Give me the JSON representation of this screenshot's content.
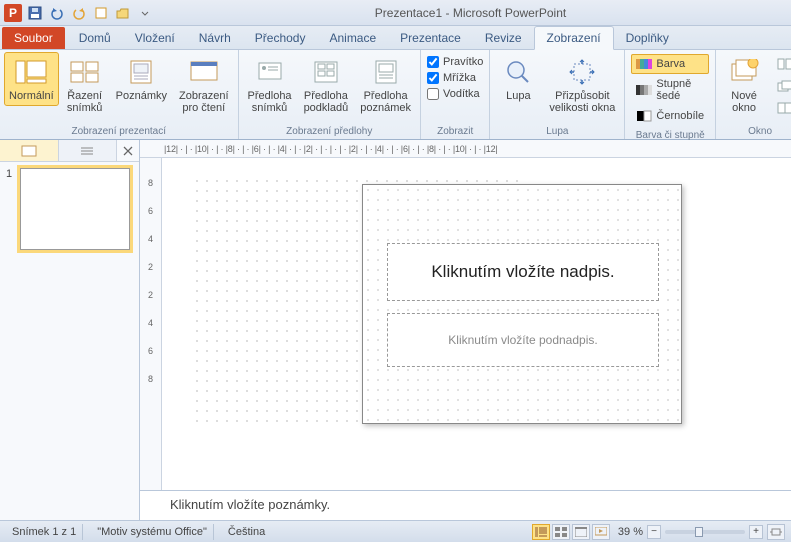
{
  "title": "Prezentace1 - Microsoft PowerPoint",
  "tabs": {
    "file": "Soubor",
    "home": "Domů",
    "insert": "Vložení",
    "design": "Návrh",
    "transitions": "Přechody",
    "animations": "Animace",
    "slideshow": "Prezentace",
    "review": "Revize",
    "view": "Zobrazení",
    "addins": "Doplňky"
  },
  "ribbon": {
    "views": {
      "normal": "Normální",
      "sorter": "Řazení\nsnímků",
      "notes": "Poznámky",
      "reading": "Zobrazení\npro čtení",
      "group": "Zobrazení prezentací"
    },
    "masters": {
      "slide": "Předloha\nsnímků",
      "handout": "Předloha\npodkladů",
      "notes": "Předloha\npoznámek",
      "group": "Zobrazení předlohy"
    },
    "show": {
      "ruler": "Pravítko",
      "grid": "Mřížka",
      "guides": "Vodítka",
      "group": "Zobrazit"
    },
    "zoom": {
      "zoom": "Lupa",
      "fit": "Přizpůsobit\nvelikosti okna",
      "group": "Lupa"
    },
    "color": {
      "color": "Barva",
      "gray": "Stupně šedé",
      "bw": "Černobíle",
      "group": "Barva či stupně šedé"
    },
    "window": {
      "new": "Nové\nokno",
      "group": "Okno"
    }
  },
  "ruler_h": "|12| · | · |10| · | · |8| · | · |6| · | · |4| · | · |2| · | · | · | · |2| · | · |4| · | · |6| · | · |8| · | · |10| · | · |12|",
  "ruler_v": [
    "8",
    "6",
    "4",
    "2",
    "2",
    "4",
    "6",
    "8"
  ],
  "slide": {
    "num": "1",
    "title_ph": "Kliknutím vložíte nadpis.",
    "sub_ph": "Kliknutím vložíte podnadpis."
  },
  "notes_ph": "Kliknutím vložíte poznámky.",
  "status": {
    "slide": "Snímek 1 z 1",
    "theme": "\"Motiv systému Office\"",
    "lang": "Čeština",
    "zoom": "39 %"
  }
}
